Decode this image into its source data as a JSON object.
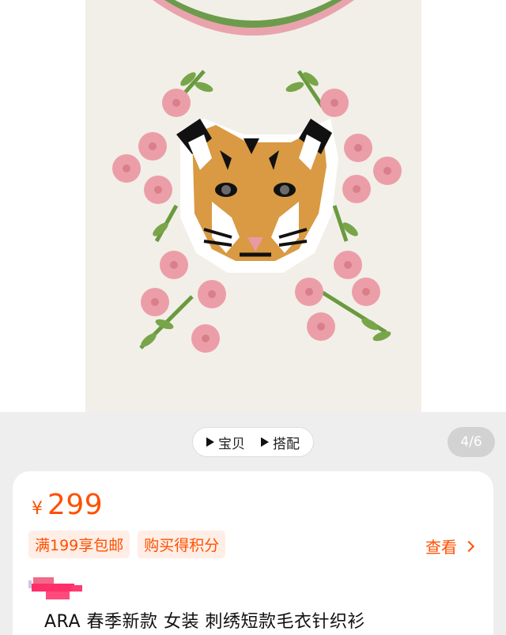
{
  "product_image": {
    "alt_icon": "product-photo"
  },
  "switcher": {
    "items": [
      {
        "label": "宝贝",
        "icon": "play-triangle-icon"
      },
      {
        "label": "搭配",
        "icon": "play-triangle-icon"
      }
    ],
    "page_indicator": "4/6"
  },
  "card": {
    "price_symbol": "¥",
    "price": "299",
    "tags": [
      "满199享包邮",
      "购买得积分"
    ],
    "view_label": "查看",
    "title": "ARA 春季新款 女装 刺绣短款毛衣针织衫"
  },
  "colors": {
    "accent": "#ff5000",
    "tag_bg": "#ffeee6",
    "background": "#eeeeee"
  }
}
